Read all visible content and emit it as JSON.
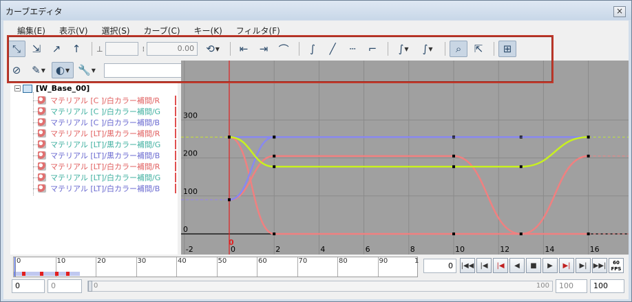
{
  "window": {
    "title": "カーブエディタ",
    "close_glyph": "×"
  },
  "menu": [
    "編集(E)",
    "表示(V)",
    "選択(S)",
    "カーブ(C)",
    "キー(K)",
    "フィルタ(F)"
  ],
  "toolbar": {
    "frame_value": "",
    "value_value": "0.00",
    "filter_combo": ""
  },
  "tree": {
    "root_label": "[W_Base_00]",
    "items": [
      {
        "label": "マテリアル [C ]/白カラー補間/R",
        "color": "#e06060"
      },
      {
        "label": "マテリアル [C ]/白カラー補間/G",
        "color": "#40b0a0"
      },
      {
        "label": "マテリアル [C ]/白カラー補間/B",
        "color": "#6a6ad0"
      },
      {
        "label": "マテリアル [LT]/黒カラー補間/R",
        "color": "#e06060"
      },
      {
        "label": "マテリアル [LT]/黒カラー補間/G",
        "color": "#40b0a0"
      },
      {
        "label": "マテリアル [LT]/黒カラー補間/B",
        "color": "#6a6ad0"
      },
      {
        "label": "マテリアル [LT]/白カラー補間/R",
        "color": "#e06060"
      },
      {
        "label": "マテリアル [LT]/白カラー補間/G",
        "color": "#40b0a0"
      },
      {
        "label": "マテリアル [LT]/白カラー補間/B",
        "color": "#6a6ad0"
      }
    ]
  },
  "graph": {
    "x_ticks": [
      "-2",
      "0",
      "2",
      "4",
      "6",
      "8",
      "10",
      "12",
      "14",
      "16"
    ],
    "y_labels": [
      "300",
      "200",
      "100",
      "0"
    ],
    "current_frame_label": "0",
    "colors": {
      "red": "#f08080",
      "green": "#c8f020",
      "blue": "#8888f0",
      "cursor": "#e02020",
      "bg": "#a0a0a0"
    }
  },
  "curves": {
    "blue": [
      [
        0,
        255
      ],
      [
        2,
        255
      ],
      [
        10,
        255
      ],
      [
        13,
        255
      ],
      [
        16,
        255
      ]
    ],
    "blue_rise": [
      [
        0,
        90
      ],
      [
        2,
        255
      ]
    ],
    "green": [
      [
        0,
        255
      ],
      [
        2,
        177
      ],
      [
        10,
        177
      ],
      [
        13,
        177
      ],
      [
        16,
        255
      ]
    ],
    "red_high": [
      [
        0,
        255
      ],
      [
        2,
        0
      ],
      [
        10,
        0
      ],
      [
        13,
        0
      ],
      [
        16,
        205
      ]
    ],
    "red_low": [
      [
        0,
        90
      ],
      [
        2,
        205
      ],
      [
        10,
        205
      ],
      [
        13,
        0
      ],
      [
        16,
        0
      ]
    ]
  },
  "timeline": {
    "labels": [
      "0",
      "10",
      "20",
      "30",
      "40",
      "50",
      "60",
      "70",
      "80",
      "90"
    ],
    "end_label": "1"
  },
  "playback": {
    "current_frame": "0",
    "fps_top": "60",
    "fps_bottom": "FPS"
  },
  "range": {
    "start": "0",
    "start2": "0",
    "slider_left": "0",
    "slider_right": "100",
    "end1": "100",
    "end2": "100"
  }
}
